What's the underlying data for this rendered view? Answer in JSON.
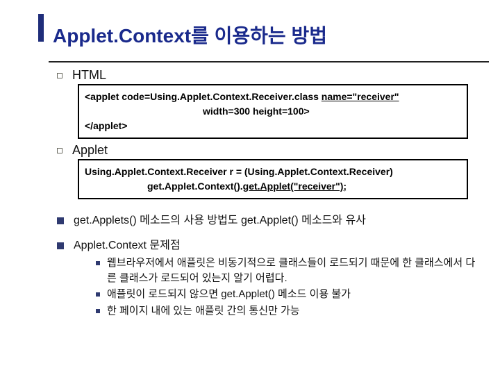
{
  "title": "Applet.Context를 이용하는 방법",
  "sections": {
    "html_label": "HTML",
    "html_code": {
      "line1_pre": "<applet code=Using.Applet.Context.Receiver.class ",
      "line1_u": "name=\"receiver\"",
      "line2": "width=300 height=100>",
      "line3": "</applet>"
    },
    "applet_label": "Applet",
    "applet_code": {
      "line1": "Using.Applet.Context.Receiver r = (Using.Applet.Context.Receiver)",
      "line2_pre": "get.Applet.Context().",
      "line2_u": "get.Applet(\"receiver\");"
    },
    "point1": "get.Applets() 메소드의 사용 방법도 get.Applet() 메소드와 유사",
    "point2_label": "Applet.Context 문제점",
    "point2_items": [
      "웹브라우저에서 애플릿은 비동기적으로 클래스들이 로드되기 때문에 한 클래스에서 다른 클래스가 로드되어 있는지 알기 어렵다.",
      "애플릿이 로드되지 않으면 get.Applet() 메소드 이용 불가",
      "한 페이지 내에 있는 애플릿 간의        통신만 가능"
    ]
  }
}
